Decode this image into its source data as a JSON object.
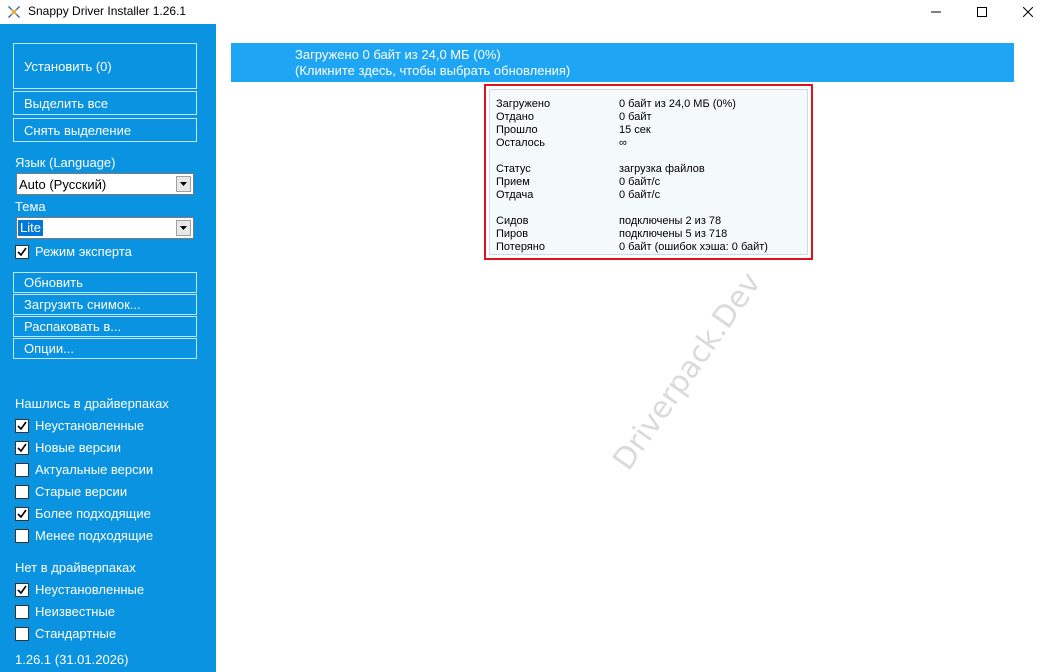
{
  "window": {
    "title": "Snappy Driver Installer 1.26.1"
  },
  "sidebar": {
    "install_button": "Установить (0)",
    "select_all_button": "Выделить все",
    "deselect_button": "Снять выделение",
    "language_label": "Язык (Language)",
    "language_value": "Auto (Русский)",
    "theme_label": "Тема",
    "theme_value": "Lite",
    "expert_mode": {
      "label": "Режим эксперта",
      "checked": true
    },
    "refresh_button": "Обновить",
    "load_snapshot_button": "Загрузить снимок...",
    "extract_button": "Распаковать в...",
    "options_button": "Опции...",
    "found_header": "Нашлись в драйверпаках",
    "found_filters": [
      {
        "label": "Неустановленные",
        "checked": true
      },
      {
        "label": "Новые версии",
        "checked": true
      },
      {
        "label": "Актуальные версии",
        "checked": false
      },
      {
        "label": "Старые версии",
        "checked": false
      },
      {
        "label": "Более подходящие",
        "checked": true
      },
      {
        "label": "Менее подходящие",
        "checked": false
      }
    ],
    "notfound_header": "Нет в драйверпаках",
    "notfound_filters": [
      {
        "label": "Неустановленные",
        "checked": true
      },
      {
        "label": "Неизвестные",
        "checked": false
      },
      {
        "label": "Стандартные",
        "checked": false
      }
    ],
    "version": "1.26.1 (31.01.2026)"
  },
  "banner": {
    "line1": "Загружено 0 байт из 24,0 МБ (0%)",
    "line2": "(Кликните здесь, чтобы выбрать обновления)"
  },
  "popup": {
    "rows": [
      {
        "key": "Загружено",
        "value": "0 байт из 24,0 МБ (0%)"
      },
      {
        "key": "Отдано",
        "value": "0 байт"
      },
      {
        "key": "Прошло",
        "value": "15 сек"
      },
      {
        "key": "Осталось",
        "value": "∞"
      },
      {
        "key": "Статус",
        "value": "загрузка файлов"
      },
      {
        "key": "Прием",
        "value": "0 байт/с"
      },
      {
        "key": "Отдача",
        "value": "0 байт/с"
      },
      {
        "key": "Сидов",
        "value": "подключены 2 из 78"
      },
      {
        "key": "Пиров",
        "value": "подключены 5 из 718"
      },
      {
        "key": "Потеряно",
        "value": "0 байт (ошибок хэша: 0 байт)"
      }
    ]
  },
  "watermark": "Driverpack.Dev",
  "colors": {
    "sidebar_bg": "#0a93e0",
    "banner_bg": "#1ea6f5",
    "popup_border": "#d8141e"
  }
}
